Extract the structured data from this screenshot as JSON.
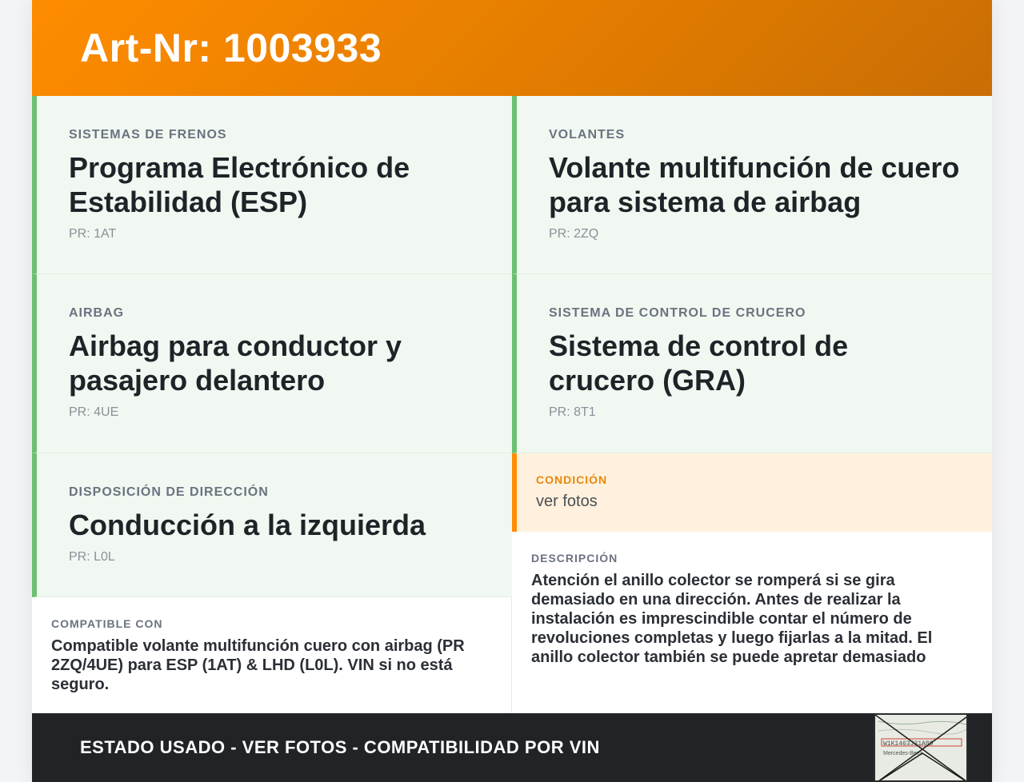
{
  "header": {
    "title": "Art-Nr: 1003933"
  },
  "features": [
    {
      "category": "SISTEMAS DE FRENOS",
      "title": "Programa Electrónico de Estabilidad (ESP)",
      "pr": "PR: 1AT"
    },
    {
      "category": "VOLANTES",
      "title": "Volante multifunción de cuero para sistema de airbag",
      "pr": "PR: 2ZQ"
    },
    {
      "category": "AIRBAG",
      "title": "Airbag para conductor y pasajero delantero",
      "pr": "PR: 4UE"
    },
    {
      "category": "SISTEMA DE CONTROL DE CRUCERO",
      "title": "Sistema de control de crucero (GRA)",
      "pr": "PR: 8T1"
    },
    {
      "category": "DISPOSICIÓN DE DIRECCIÓN",
      "title": "Conducción a la izquierda",
      "pr": "PR: L0L"
    }
  ],
  "condition": {
    "label": "CONDICIÓN",
    "value": "ver fotos"
  },
  "compatible": {
    "label": "COMPATIBLE CON",
    "text": "Compatible volante multifunción cuero con airbag (PR 2ZQ/4UE) para ESP (1AT) & LHD (L0L). VIN si no está seguro."
  },
  "description": {
    "label": "DESCRIPCIÓN",
    "text": "Atención el anillo colector se romperá si se gira demasiado en una dirección. Antes de realizar la instalación es imprescindible contar el número de revoluciones completas y luego fijarlas a la mitad. El anillo colector también se puede apretar demasiado"
  },
  "footer": {
    "slogan": "ESTADO USADO - VER FOTOS - COMPATIBILIDAD POR VIN",
    "thumbnail_icon": "envelope-document-icon",
    "thumbnail_text": {
      "vin": "W1K1463J31A89",
      "brand": "Mercedes-Benz"
    }
  },
  "colors": {
    "accent_orange": "#ff8c00",
    "feature_green": "#6cc070",
    "footer_dark": "#212427"
  }
}
